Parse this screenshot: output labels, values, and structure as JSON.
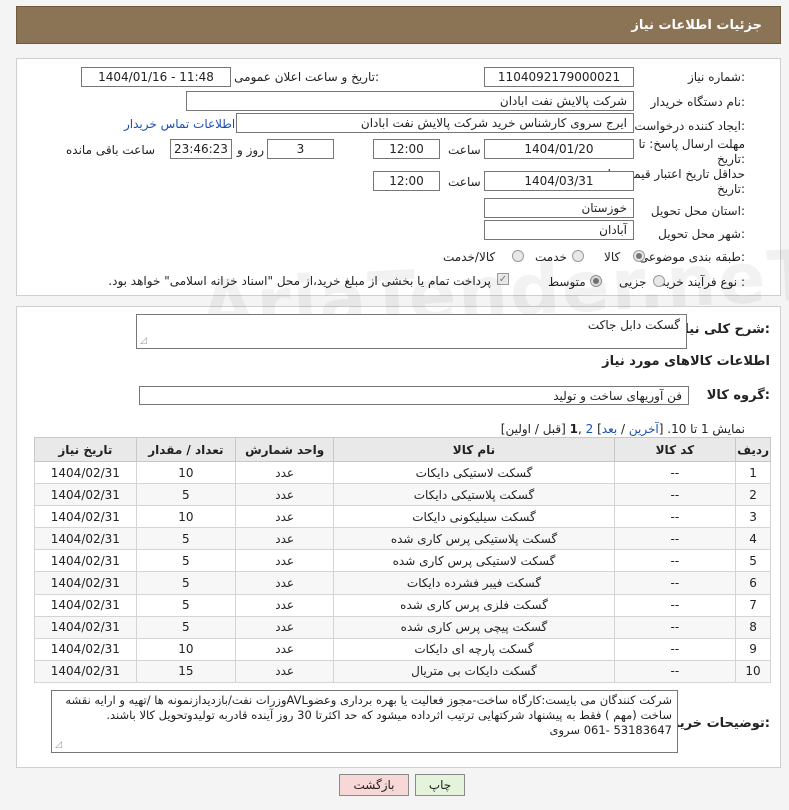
{
  "header": {
    "title": "جزئیات اطلاعات نیاز"
  },
  "form": {
    "need_number_label": "شماره نیاز:",
    "need_number": "1104092179000021",
    "announce_label": "تاریخ و ساعت اعلان عمومی:",
    "announce_value": "1404/01/16 - 11:48",
    "buyer_org_label": "نام دستگاه خریدار:",
    "buyer_org": "شرکت پالایش نفت ابادان",
    "creator_label": "ایجاد کننده درخواست:",
    "creator": "ایرج سروی کارشناس خرید شرکت پالایش نفت ابادان",
    "contact_link": "اطلاعات تماس خریدار",
    "deadline_label_1": "مهلت ارسال پاسخ: تا",
    "deadline_label_2": "تاریخ:",
    "deadline_date": "1404/01/20",
    "time_label": "ساعت",
    "deadline_time": "12:00",
    "days": "3",
    "days_label": "روز و",
    "remaining": "23:46:23",
    "remaining_label": "ساعت باقی مانده",
    "validity_label_1": "حداقل تاریخ اعتبار قیمت: تا",
    "validity_label_2": "تاریخ:",
    "validity_date": "1404/03/31",
    "validity_time": "12:00",
    "province_label": "استان محل تحویل:",
    "province": "خوزستان",
    "city_label": "شهر محل تحویل:",
    "city": "آبادان",
    "category_label": "طبقه بندی موضوعی:",
    "category_options": [
      "کالا",
      "خدمت",
      "کالا/خدمت"
    ],
    "process_label": "نوع فرآیند خرید :",
    "process_options": [
      "جزیی",
      "متوسط"
    ],
    "payment_note": "پرداخت تمام یا بخشی از مبلغ خرید،از محل \"اسناد خزانه اسلامی\" خواهد بود."
  },
  "details": {
    "summary_label": "شرح کلی نیاز:",
    "summary": "گسکت دابل جاکت",
    "goods_info_title": "اطلاعات کالاهای مورد نیاز",
    "group_label": "گروه کالا:",
    "group": "فن آوریهای ساخت و تولید",
    "pager_prefix": "نمایش 1 تا 10. [",
    "pager_last": "آخرین",
    "pager_sep1": " / ",
    "pager_next": "بعد",
    "pager_sep2": "] ",
    "pager_page2": "2",
    "pager_comma": " ,",
    "pager_page1": "1",
    "pager_suffix": " [قبل / اولین]",
    "columns": [
      "ردیف",
      "کد کالا",
      "نام کالا",
      "واحد شمارش",
      "تعداد / مقدار",
      "تاریخ نیاز"
    ],
    "rows": [
      [
        "1",
        "--",
        "گسکت لاستیکی دایکات",
        "عدد",
        "10",
        "1404/02/31"
      ],
      [
        "2",
        "--",
        "گسکت پلاستیکی دایکات",
        "عدد",
        "5",
        "1404/02/31"
      ],
      [
        "3",
        "--",
        "گسکت سیلیکونی دایکات",
        "عدد",
        "10",
        "1404/02/31"
      ],
      [
        "4",
        "--",
        "گسکت پلاستیکی پرس کاری شده",
        "عدد",
        "5",
        "1404/02/31"
      ],
      [
        "5",
        "--",
        "گسکت لاستیکی پرس کاری شده",
        "عدد",
        "5",
        "1404/02/31"
      ],
      [
        "6",
        "--",
        "گسکت فیبر فشرده دایکات",
        "عدد",
        "5",
        "1404/02/31"
      ],
      [
        "7",
        "--",
        "گسکت فلزی پرس کاری شده",
        "عدد",
        "5",
        "1404/02/31"
      ],
      [
        "8",
        "--",
        "گسکت پیچی پرس کاری شده",
        "عدد",
        "5",
        "1404/02/31"
      ],
      [
        "9",
        "--",
        "گسکت پارچه ای دایکات",
        "عدد",
        "10",
        "1404/02/31"
      ],
      [
        "10",
        "--",
        "گسکت دایکات بی متریال",
        "عدد",
        "15",
        "1404/02/31"
      ]
    ],
    "buyer_notes_label": "توضیحات خریدار:",
    "buyer_notes": "شرکت کنندگان می بایست:کارگاه ساخت-مجوز فعالیت یا بهره برداری وعضوAVLوزرات نفت/بازدیدازنمونه ها /تهیه و ارایه نقشه ساخت (مهم ) فقط به پیشنهاد شرکتهایی ترتیب اثرداده میشود که حد اکثرتا 30 روز آینده قادربه تولیدوتحویل کالا باشند. 53183647 -061 سروی"
  },
  "buttons": {
    "print": "چاپ",
    "back": "بازگشت"
  },
  "colors": {
    "header_bg": "#8b7355",
    "link": "#1a4fb3",
    "back_btn_bg": "#f8d7d7",
    "print_btn_bg": "#e4f4dc"
  }
}
